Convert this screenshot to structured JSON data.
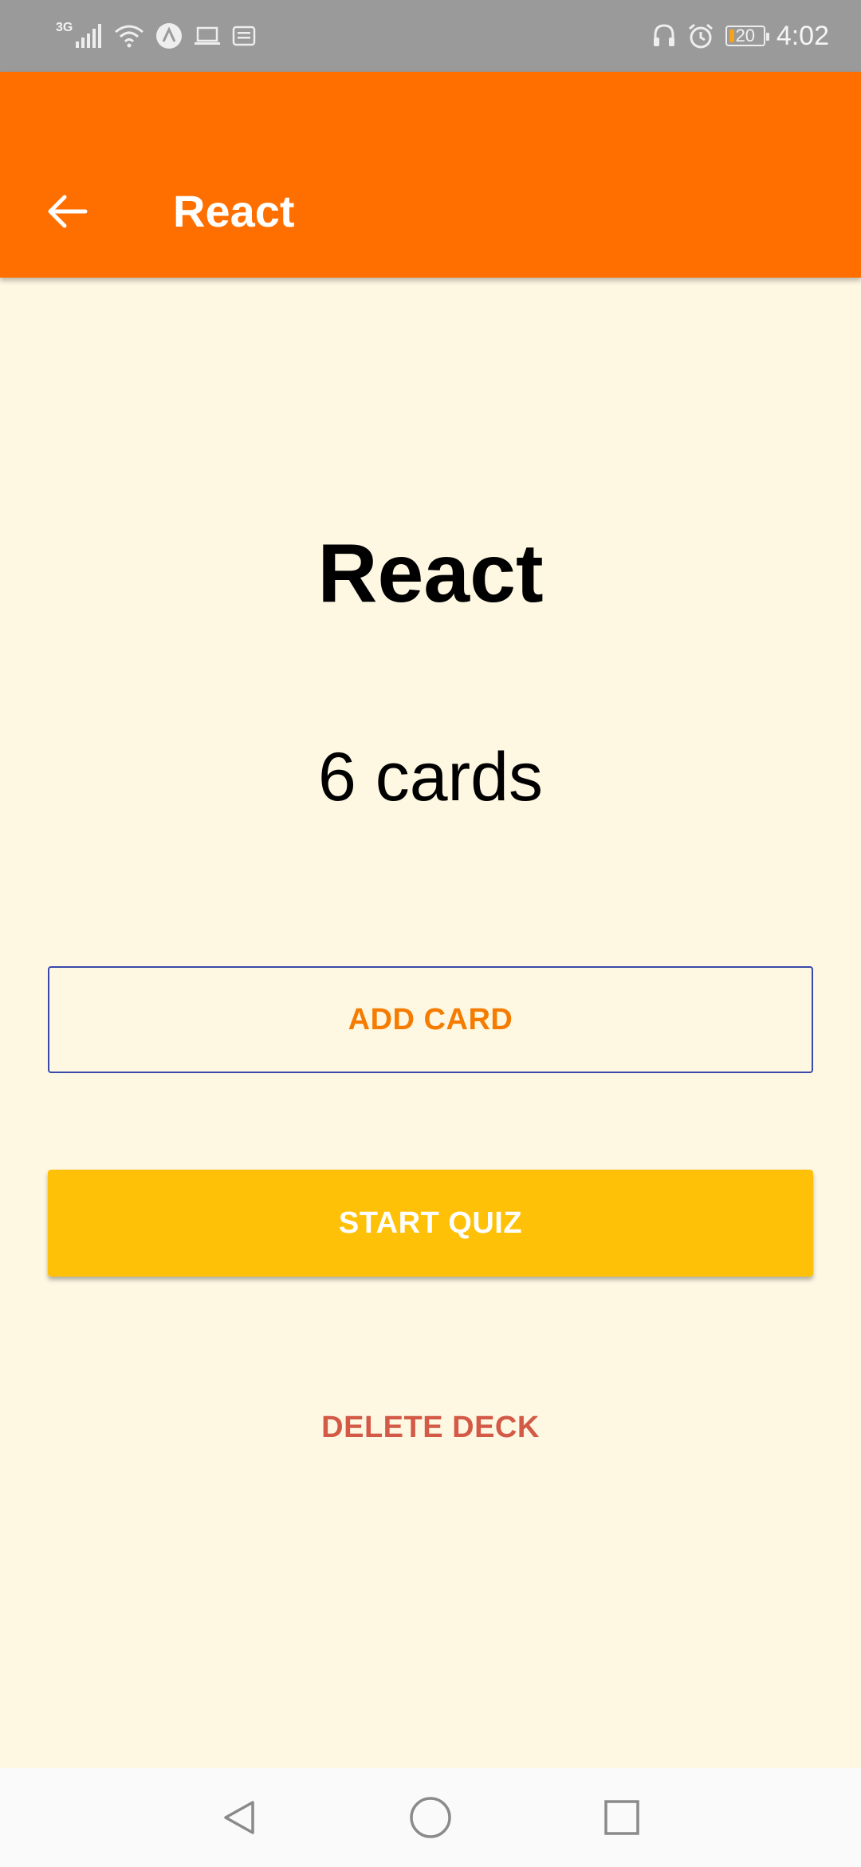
{
  "status_bar": {
    "network": "3G",
    "time": "4:02",
    "battery_level": "20",
    "colors": {
      "background": "#9A9A9A",
      "battery_charge": "#F7A21B"
    },
    "icons": [
      "signal-icon",
      "wifi-icon",
      "app-a-icon",
      "laptop-icon",
      "notification-icon",
      "headphones-icon",
      "alarm-icon",
      "battery-icon"
    ]
  },
  "app_bar": {
    "title": "React",
    "back_icon": "arrow-left-icon",
    "color": "#FF6F00"
  },
  "deck": {
    "title": "React",
    "card_count": "6 cards"
  },
  "actions": {
    "add_card_label": "ADD CARD",
    "start_quiz_label": "START QUIZ",
    "delete_deck_label": "DELETE DECK",
    "colors": {
      "add_card_text": "#F57C00",
      "add_card_border": "#3949AB",
      "start_quiz_bg": "#FFC107",
      "delete_text": "#D35A46"
    }
  },
  "nav_bar": {
    "icons": [
      "nav-back-icon",
      "nav-home-icon",
      "nav-recent-icon"
    ]
  },
  "page": {
    "background": "#FEF8E3"
  }
}
